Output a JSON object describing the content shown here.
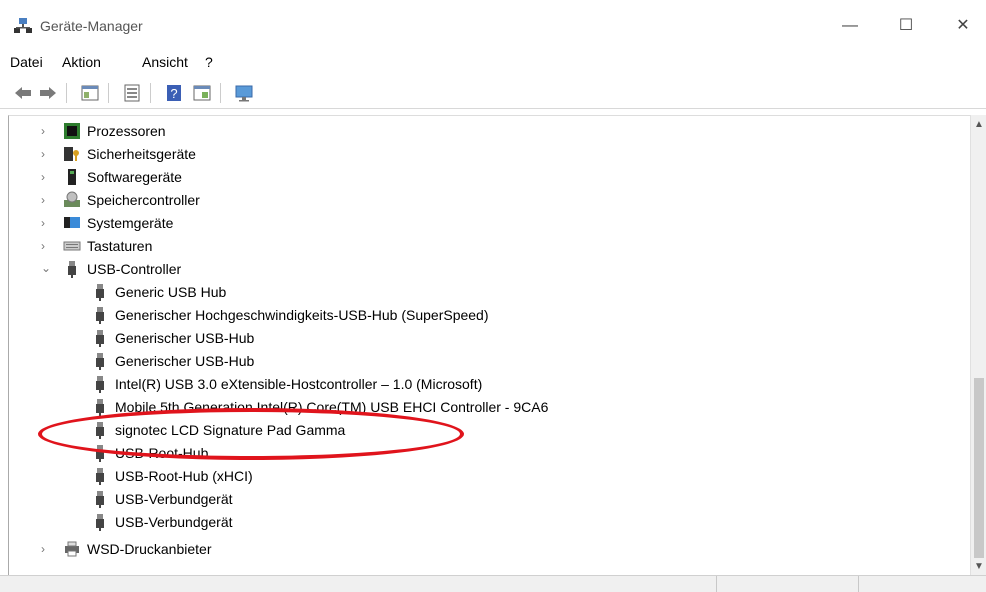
{
  "window": {
    "title": "Geräte-Manager"
  },
  "menu": {
    "items": [
      "Datei",
      "Aktion",
      "Ansicht",
      "?"
    ]
  },
  "tree": {
    "categories": [
      {
        "label": "Prozessoren",
        "icon": "processor-icon",
        "expanded": false
      },
      {
        "label": "Sicherheitsgeräte",
        "icon": "security-device-icon",
        "expanded": false
      },
      {
        "label": "Softwaregeräte",
        "icon": "software-device-icon",
        "expanded": false
      },
      {
        "label": "Speichercontroller",
        "icon": "storage-controller-icon",
        "expanded": false
      },
      {
        "label": "Systemgeräte",
        "icon": "system-device-icon",
        "expanded": false
      },
      {
        "label": "Tastaturen",
        "icon": "keyboard-icon",
        "expanded": false
      },
      {
        "label": "USB-Controller",
        "icon": "usb-icon",
        "expanded": true
      },
      {
        "label": "WSD-Druckanbieter",
        "icon": "printer-icon",
        "expanded": false
      }
    ],
    "usb_children": [
      "Generic USB Hub",
      "Generischer Hochgeschwindigkeits-USB-Hub (SuperSpeed)",
      "Generischer USB-Hub",
      "Generischer USB-Hub",
      "Intel(R) USB 3.0 eXtensible-Hostcontroller – 1.0 (Microsoft)",
      "Mobile 5th Generation Intel(R) Core(TM) USB EHCI Controller - 9CA6",
      "signotec LCD Signature Pad Gamma",
      "USB-Root-Hub",
      "USB-Root-Hub (xHCI)",
      "USB-Verbundgerät",
      "USB-Verbundgerät"
    ]
  },
  "annotation": {
    "color": "#e0141c"
  }
}
